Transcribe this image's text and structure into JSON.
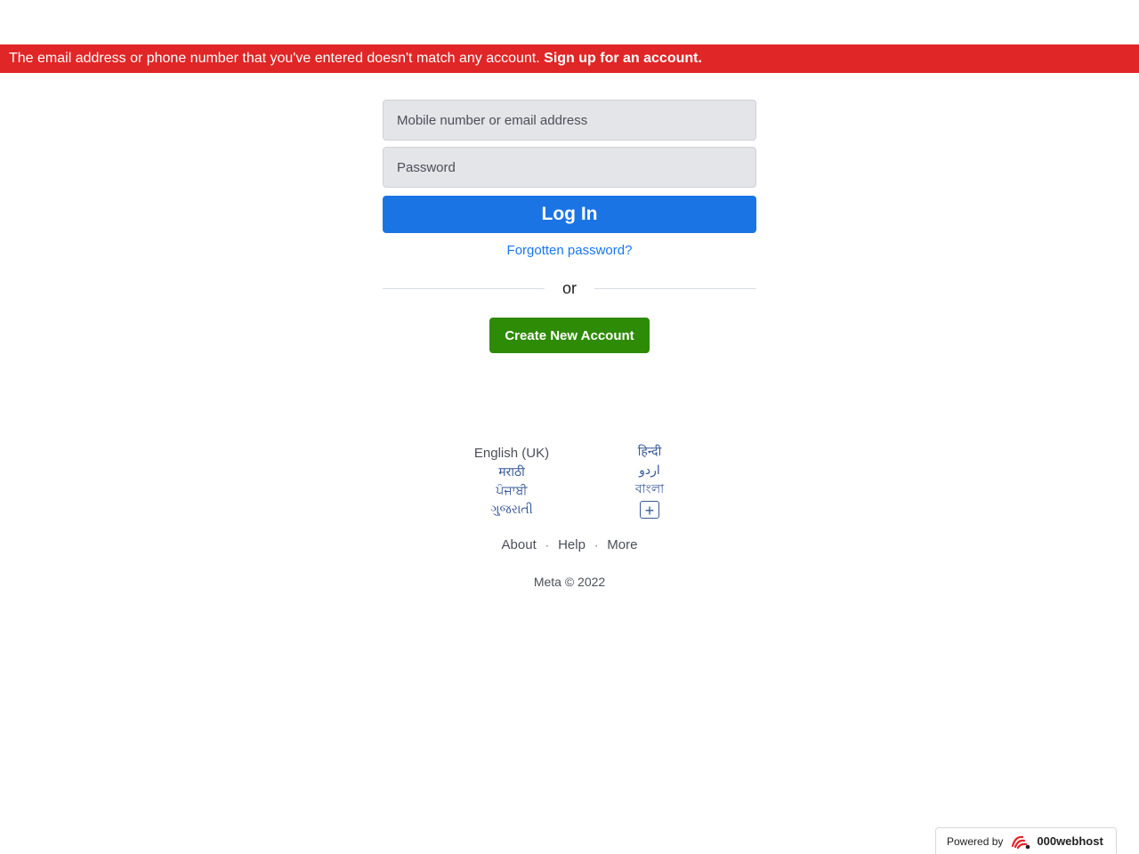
{
  "error_banner": {
    "message": "The email address or phone number that you've entered doesn't match any account.",
    "signup_link": "Sign up for an account."
  },
  "login": {
    "email_placeholder": "Mobile number or email address",
    "password_placeholder": "Password",
    "login_button": "Log In",
    "forgot_link": "Forgotten password?",
    "divider_text": "or",
    "create_account_button": "Create New Account"
  },
  "languages": {
    "left": [
      "English (UK)",
      "मराठी",
      "ਪੰਜਾਬੀ",
      "ગુજરાતી"
    ],
    "right": [
      "हिन्दी",
      "اردو",
      "বাংলা"
    ],
    "more_symbol": "+"
  },
  "footer": {
    "links": [
      "About",
      "Help",
      "More"
    ],
    "separator": "·",
    "copyright": "Meta © 2022"
  },
  "badge": {
    "powered_by": "Powered by",
    "brand": "000webhost"
  },
  "colors": {
    "error_banner": "#e02626",
    "login_button": "#1b74e4",
    "create_button": "#2e8b06",
    "link": "#1877f2"
  }
}
